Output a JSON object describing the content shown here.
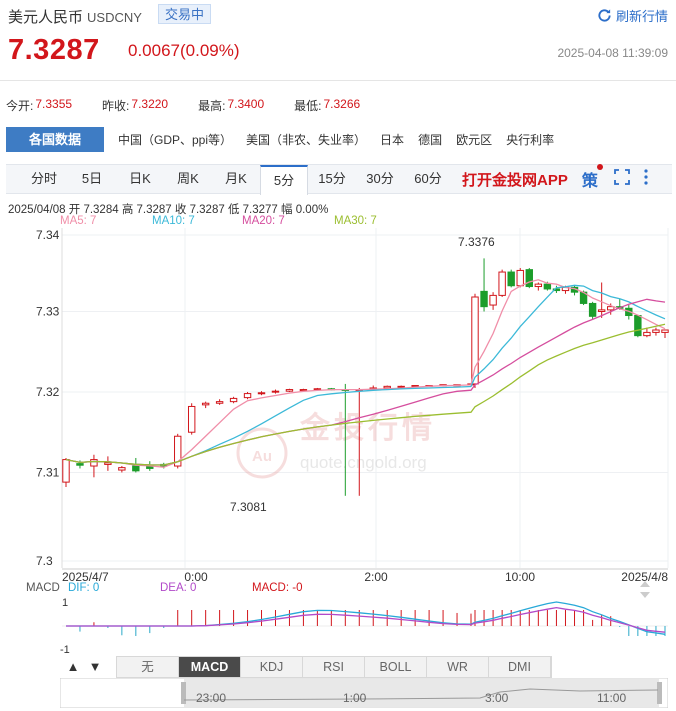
{
  "header": {
    "name": "美元人民币",
    "code": "USDCNY",
    "status": "交易中",
    "refresh_label": "刷新行情",
    "price": "7.3287",
    "change": "0.0067(0.09%)",
    "timestamp": "2025-04-08 11:39:09"
  },
  "stats": [
    {
      "label": "今开:",
      "value": "7.3355"
    },
    {
      "label": "昨收:",
      "value": "7.3220"
    },
    {
      "label": "最高:",
      "value": "7.3400"
    },
    {
      "label": "最低:",
      "value": "7.3266"
    }
  ],
  "countries": {
    "main": "各国数据",
    "items": [
      "中国（GDP、ppi等）",
      "美国（非农、失业率）",
      "日本",
      "德国",
      "欧元区",
      "央行利率"
    ]
  },
  "tabs": [
    "分时",
    "5日",
    "日K",
    "周K",
    "月K",
    "5分",
    "15分",
    "30分",
    "60分"
  ],
  "active_tab": "5分",
  "app_label": "打开金投网APP",
  "strategy_label": "策",
  "bar_info": "2025/04/08  开 7.3284  高 7.3287  收 7.3287  低 7.3277  幅 0.00%",
  "ma_legend": [
    {
      "label": "MA5: 7",
      "color": "#f08ea8"
    },
    {
      "label": "MA10: 7",
      "color": "#3cb9d8"
    },
    {
      "label": "MA20: 7",
      "color": "#d54e9e"
    },
    {
      "label": "MA30: 7",
      "color": "#9bbe30"
    }
  ],
  "watermark": {
    "cn": "金投行情",
    "url": "quote.cngold.org",
    "logo": "Au"
  },
  "chart_data": {
    "type": "candlestick",
    "y_ticks": [
      "7.34",
      "7.33",
      "7.32",
      "7.31",
      "7.3"
    ],
    "ylim": [
      7.3,
      7.341
    ],
    "x_ticks": [
      "2025/4/7",
      "0:00",
      "2:00",
      "10:00",
      "2025/4/8"
    ],
    "annotations": {
      "high": "7.3376",
      "low": "7.3081"
    },
    "candles": [
      [
        7.3098,
        7.3128,
        7.3092,
        7.3126
      ],
      [
        7.3121,
        7.3125,
        7.3115,
        7.3119
      ],
      [
        7.3118,
        7.3132,
        7.3104,
        7.3126
      ],
      [
        7.312,
        7.313,
        7.3112,
        7.3122
      ],
      [
        7.3113,
        7.3118,
        7.311,
        7.3116
      ],
      [
        7.3118,
        7.3128,
        7.311,
        7.3112
      ],
      [
        7.3118,
        7.3124,
        7.3112,
        7.3115
      ],
      [
        7.312,
        7.3122,
        7.3115,
        7.3118
      ],
      [
        7.3118,
        7.3158,
        7.3115,
        7.3155
      ],
      [
        7.316,
        7.3196,
        7.3157,
        7.3192
      ],
      [
        7.3194,
        7.3198,
        7.319,
        7.3196
      ],
      [
        7.3196,
        7.3201,
        7.3194,
        7.3198
      ],
      [
        7.3198,
        7.3204,
        7.3196,
        7.3202
      ],
      [
        7.3203,
        7.321,
        7.3201,
        7.3208
      ],
      [
        7.3208,
        7.3211,
        7.3206,
        7.3209
      ],
      [
        7.321,
        7.3213,
        7.3208,
        7.3211
      ],
      [
        7.3211,
        7.3214,
        7.321,
        7.3213
      ],
      [
        7.3212,
        7.3214,
        7.3211,
        7.3213
      ],
      [
        7.3213,
        7.3215,
        7.3212,
        7.3214
      ],
      [
        7.3214,
        7.3215,
        7.3212,
        7.3213
      ],
      [
        7.3213,
        7.322,
        7.3081,
        7.3212
      ],
      [
        7.3212,
        7.3215,
        7.3081,
        7.3213
      ],
      [
        7.3213,
        7.3218,
        7.3212,
        7.3215
      ],
      [
        7.3215,
        7.3218,
        7.3214,
        7.3217
      ],
      [
        7.3217,
        7.3218,
        7.3216,
        7.3217
      ],
      [
        7.3217,
        7.3218,
        7.3216,
        7.3218
      ],
      [
        7.3218,
        7.3218,
        7.3217,
        7.3218
      ],
      [
        7.3218,
        7.3219,
        7.3217,
        7.3219
      ],
      [
        7.3219,
        7.3219,
        7.3218,
        7.3219
      ],
      [
        7.3219,
        7.322,
        7.3219,
        7.322
      ],
      [
        7.322,
        7.3332,
        7.3215,
        7.3328
      ],
      [
        7.3335,
        7.3376,
        7.331,
        7.3316
      ],
      [
        7.3318,
        7.3334,
        7.3312,
        7.333
      ],
      [
        7.333,
        7.3362,
        7.3328,
        7.3359
      ],
      [
        7.3359,
        7.3362,
        7.334,
        7.3342
      ],
      [
        7.3342,
        7.3364,
        7.334,
        7.3361
      ],
      [
        7.3362,
        7.3364,
        7.3339,
        7.3341
      ],
      [
        7.3341,
        7.3346,
        7.3336,
        7.3344
      ],
      [
        7.3344,
        7.3347,
        7.3336,
        7.3338
      ],
      [
        7.3338,
        7.3342,
        7.3333,
        7.3336
      ],
      [
        7.3336,
        7.3342,
        7.3332,
        7.334
      ],
      [
        7.334,
        7.3342,
        7.333,
        7.3334
      ],
      [
        7.3334,
        7.3336,
        7.3318,
        7.332
      ],
      [
        7.332,
        7.3322,
        7.33,
        7.3304
      ],
      [
        7.331,
        7.3346,
        7.3302,
        7.3312
      ],
      [
        7.3312,
        7.332,
        7.3306,
        7.3316
      ],
      [
        7.3316,
        7.3326,
        7.3312,
        7.3314
      ],
      [
        7.3314,
        7.3318,
        7.33,
        7.3305
      ],
      [
        7.3305,
        7.3306,
        7.3278,
        7.328
      ],
      [
        7.328,
        7.329,
        7.3278,
        7.3284
      ],
      [
        7.3284,
        7.329,
        7.328,
        7.3287
      ],
      [
        7.3284,
        7.3287,
        7.3277,
        7.3287
      ]
    ],
    "macd": {
      "labels": {
        "name": "MACD",
        "dif": "DIF: 0",
        "dea": "DEA: 0",
        "macd": "MACD: -0"
      },
      "y_ticks": [
        "1",
        "-1"
      ]
    }
  },
  "indicators": [
    "无",
    "MACD",
    "KDJ",
    "RSI",
    "BOLL",
    "WR",
    "DMI"
  ],
  "active_indicator": "MACD",
  "navigator_ticks": [
    "23:00",
    "1:00",
    "3:00",
    "11:00"
  ],
  "colors": {
    "up": "#d2161b",
    "down": "#1c9d2b",
    "accent": "#2c6ec9"
  }
}
